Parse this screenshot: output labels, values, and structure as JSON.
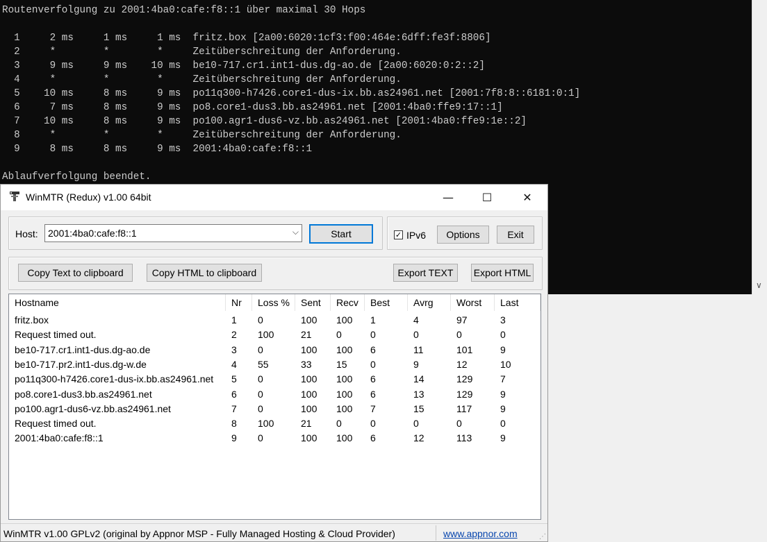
{
  "console": {
    "lines": [
      "Routenverfolgung zu 2001:4ba0:cafe:f8::1 über maximal 30 Hops",
      "",
      "  1     2 ms     1 ms     1 ms  fritz.box [2a00:6020:1cf3:f00:464e:6dff:fe3f:8806]",
      "  2     *        *        *     Zeitüberschreitung der Anforderung.",
      "  3     9 ms     9 ms    10 ms  be10-717.cr1.int1-dus.dg-ao.de [2a00:6020:0:2::2]",
      "  4     *        *        *     Zeitüberschreitung der Anforderung.",
      "  5    10 ms     8 ms     9 ms  po11q300-h7426.core1-dus-ix.bb.as24961.net [2001:7f8:8::6181:0:1]",
      "  6     7 ms     8 ms     9 ms  po8.core1-dus3.bb.as24961.net [2001:4ba0:ffe9:17::1]",
      "  7    10 ms     8 ms     9 ms  po100.agr1-dus6-vz.bb.as24961.net [2001:4ba0:ffe9:1e::2]",
      "  8     *        *        *     Zeitüberschreitung der Anforderung.",
      "  9     8 ms     8 ms     9 ms  2001:4ba0:cafe:f8::1",
      "",
      "Ablaufverfolgung beendet."
    ],
    "scroll_icon": "chevron-down-icon"
  },
  "window": {
    "title": "WinMTR (Redux) v1.00 64bit",
    "minimize": "—",
    "maximize": "☐",
    "close": "✕"
  },
  "host": {
    "label": "Host:",
    "value": "2001:4ba0:cafe:f8::1",
    "dropdown": "⌵"
  },
  "buttons": {
    "start": "Start",
    "ipv6_label": "IPv6",
    "ipv6_checked": "✓",
    "options": "Options",
    "exit": "Exit",
    "copy_text": "Copy Text to clipboard",
    "copy_html": "Copy HTML to clipboard",
    "export_text": "Export TEXT",
    "export_html": "Export HTML"
  },
  "table": {
    "headers": [
      "Hostname",
      "Nr",
      "Loss %",
      "Sent",
      "Recv",
      "Best",
      "Avrg",
      "Worst",
      "Last"
    ],
    "rows": [
      [
        "fritz.box",
        "1",
        "0",
        "100",
        "100",
        "1",
        "4",
        "97",
        "3"
      ],
      [
        "Request timed out.",
        "2",
        "100",
        "21",
        "0",
        "0",
        "0",
        "0",
        "0"
      ],
      [
        "be10-717.cr1.int1-dus.dg-ao.de",
        "3",
        "0",
        "100",
        "100",
        "6",
        "11",
        "101",
        "9"
      ],
      [
        "be10-717.pr2.int1-dus.dg-w.de",
        "4",
        "55",
        "33",
        "15",
        "0",
        "9",
        "12",
        "10"
      ],
      [
        "po11q300-h7426.core1-dus-ix.bb.as24961.net",
        "5",
        "0",
        "100",
        "100",
        "6",
        "14",
        "129",
        "7"
      ],
      [
        "po8.core1-dus3.bb.as24961.net",
        "6",
        "0",
        "100",
        "100",
        "6",
        "13",
        "129",
        "9"
      ],
      [
        "po100.agr1-dus6-vz.bb.as24961.net",
        "7",
        "0",
        "100",
        "100",
        "7",
        "15",
        "117",
        "9"
      ],
      [
        "Request timed out.",
        "8",
        "100",
        "21",
        "0",
        "0",
        "0",
        "0",
        "0"
      ],
      [
        "2001:4ba0:cafe:f8::1",
        "9",
        "0",
        "100",
        "100",
        "6",
        "12",
        "113",
        "9"
      ]
    ]
  },
  "status": {
    "text": "WinMTR v1.00 GPLv2 (original by Appnor MSP - Fully Managed Hosting & Cloud Provider)",
    "link": "www.appnor.com"
  }
}
